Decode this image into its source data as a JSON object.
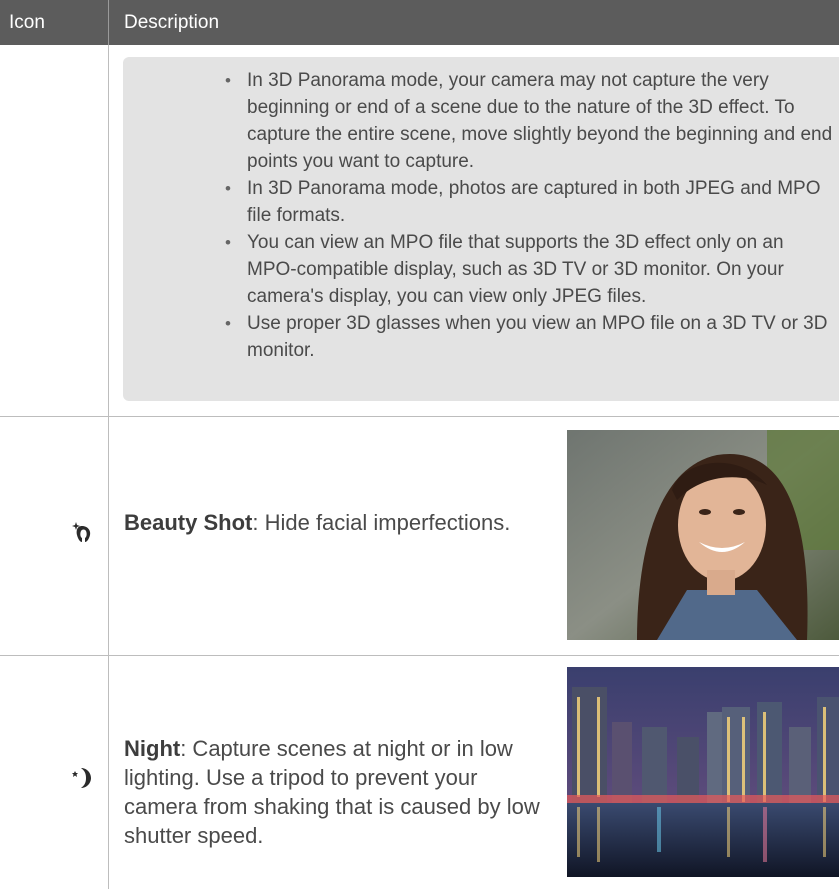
{
  "header": {
    "icon_col": "Icon",
    "desc_col": "Description"
  },
  "note": {
    "items": [
      "In 3D Panorama mode, your camera may not capture the very beginning or end of a scene due to the nature of the 3D effect. To capture the entire scene, move slightly beyond the beginning and end points you want to capture.",
      "In 3D Panorama mode, photos are captured in both JPEG and MPO file formats.",
      "You can view an MPO file that supports the 3D effect only on an MPO-compatible display, such as 3D TV or 3D monitor. On your camera's display, you can view only JPEG files.",
      "Use proper 3D glasses when you view an MPO file on a 3D TV or 3D monitor."
    ]
  },
  "rows": [
    {
      "icon": "beauty-shot-icon",
      "term": "Beauty Shot",
      "rest": ": Hide facial imperfections.",
      "image": "smiling-woman-portrait"
    },
    {
      "icon": "night-icon",
      "term": "Night",
      "rest": ": Capture scenes at night or in low lighting. Use a tripod to prevent your camera from shaking that is caused by low shutter speed.",
      "image": "night-city-skyline"
    }
  ],
  "colors": {
    "header_bg": "#5c5c5c",
    "note_bg": "#e3e3e3",
    "rule": "#bdbdbd"
  }
}
